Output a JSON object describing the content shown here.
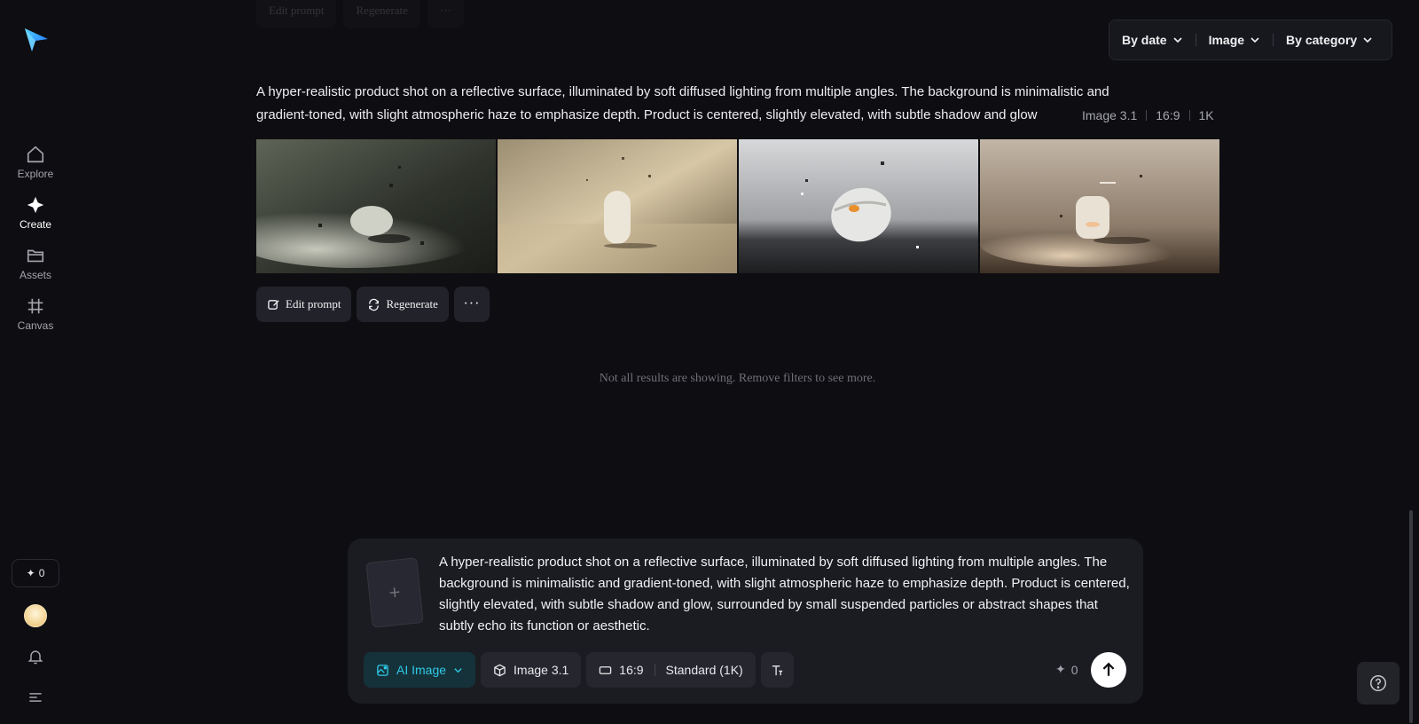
{
  "sidebar": {
    "items": [
      {
        "label": "Explore",
        "icon": "home-icon"
      },
      {
        "label": "Create",
        "icon": "sparkle-icon"
      },
      {
        "label": "Assets",
        "icon": "folder-icon"
      },
      {
        "label": "Canvas",
        "icon": "frame-icon"
      }
    ],
    "credits": "0"
  },
  "ghost_actions": {
    "edit": "Edit prompt",
    "regenerate": "Regenerate"
  },
  "filters": {
    "date": "By date",
    "type": "Image",
    "category": "By category"
  },
  "generation": {
    "prompt_line1": "A hyper-realistic product shot on a reflective surface, illuminated by soft diffused lighting from multiple angles. The background is minimalistic and",
    "prompt_line2": "gradient-toned, with slight atmospheric haze to emphasize depth. Product is centered, slightly elevated, with subtle shadow and glow",
    "model": "Image 3.1",
    "ratio": "16:9",
    "resolution": "1K",
    "images": [
      "product-shot-1",
      "product-shot-2",
      "product-shot-3",
      "product-shot-4"
    ]
  },
  "actions": {
    "edit": "Edit prompt",
    "regenerate": "Regenerate",
    "more": "···"
  },
  "notice": "Not all results are showing. Remove filters to see more.",
  "composer": {
    "text": "A hyper-realistic product shot on a reflective surface, illuminated by soft diffused lighting from multiple angles. The background is minimalistic and gradient-toned, with slight atmospheric haze to emphasize depth. Product is centered, slightly elevated, with subtle shadow and glow, surrounded by small suspended particles or abstract shapes that subtly echo its function or aesthetic.",
    "mode": "AI Image",
    "model": "Image 3.1",
    "ratio": "16:9",
    "quality": "Standard (1K)",
    "cost": "0"
  },
  "colors": {
    "accent": "#2ec9e6",
    "background": "#0e0e12",
    "panel": "#1b1c21"
  }
}
